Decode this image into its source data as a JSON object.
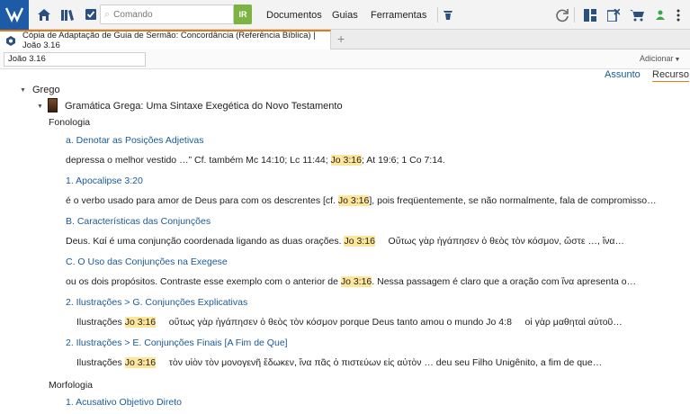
{
  "toolbar": {
    "search_placeholder": "Comando",
    "go_label": "IR",
    "menu": [
      "Documentos",
      "Guias",
      "Ferramentas"
    ],
    "status_color": "#3aa84a"
  },
  "tab": {
    "title": "Cópia de Adaptação de Guia de Sermão: Concordância (Referência Bíblica) | João 3.16",
    "add_label": "+",
    "adicionar_label": "Adicionar"
  },
  "reference": {
    "value": "João 3.16"
  },
  "view_tabs": {
    "assunto": "Assunto",
    "recurso": "Recurso"
  },
  "tree": {
    "grego_label": "Grego",
    "book_title": "Gramática Grega: Uma Sintaxe Exegética do Novo Testamento",
    "fonologia_label": "Fonologia",
    "morfologia_label": "Morfologia",
    "entries": [
      {
        "link": "a. Denotar as Posições Adjetivas",
        "pre": "depressa o melhor vestido …” Cf. também Mc 14:10; Lc 11:44; ",
        "hl": "Jo 3:16",
        "post": "; At 19:6; 1 Co 7:14."
      },
      {
        "link": "1. Apocalipse 3:20",
        "pre": "é o verbo usado para amor de Deus para com os descrentes [cf. ",
        "hl": "Jo 3:16",
        "post": "], pois freqüentemente, se não normalmente, fala de compromisso…"
      },
      {
        "link": "B. Características das Conjunções",
        "pre": "Deus. Καί é uma conjunção coordenada ligando as duas orações. ",
        "hl": "Jo 3:16",
        "post": "     Οὕτως γὰρ ἠγάπησεν ὁ θεὸς τὸν κόσμον, ὥστε …, ἵνα…"
      },
      {
        "link": "C. O Uso das Conjunções na Exegese",
        "pre": "ou os dois propósitos. Contraste esse exemplo com o anterior de ",
        "hl": "Jo 3:16",
        "post": ". Nessa passagem é claro que a oração com ἵνα apresenta o…"
      },
      {
        "link": "2. Ilustrações > G. Conjunções Explicativas",
        "pre": "Ilustrações ",
        "hl": "Jo 3:16",
        "post": "     οὕτως γὰρ ἠγάπησεν ὁ θεὸς τὸν κόσμον porque Deus tanto amou o mundo Jo 4:8     οἱ γὰρ μαθηταὶ αὐτοῦ…"
      },
      {
        "link": "2. Ilustrações > E. Conjunções Finais [A Fim de Que]",
        "pre": "Ilustrações ",
        "hl": "Jo 3:16",
        "post": "     τὸν υἱὸν τὸν μονογενῆ ἔδωκεν, ἵνα πᾶς ὁ πιστεύων εἰς αὐτὸν … deu seu Filho Unigênito, a fim de que…"
      }
    ],
    "morf_link": "1. Acusativo Objetivo Direto"
  }
}
